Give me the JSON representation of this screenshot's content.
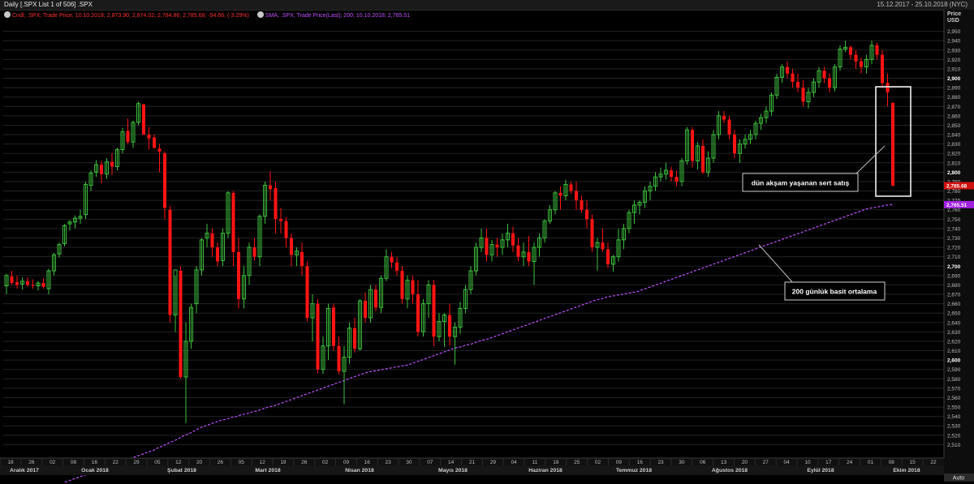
{
  "window": {
    "title": "Daily [.SPX List 1 of 506] .SPX",
    "range": "15.12.2017 - 25.10.2018 (NYC)"
  },
  "legend": {
    "series1": "Cndl; .SPX; Trade Price; 10.10.2018; 2,873.90; 2,874.02; 2,784.86; 2,785.68; -94.66; (-3.29%)",
    "series2": "SMA; .SPX; Trade Price(Last); 200; 10.10.2018; 2,765.51"
  },
  "axis": {
    "price_label": "Price",
    "currency": "USD",
    "auto_label": "Auto",
    "last_price_label": "2,785.68",
    "sma_label": "2,765.51"
  },
  "annotations": {
    "selloff": "dün akşam yaşanan sert satış",
    "sma": "200 günlük basit ortalama"
  },
  "colors": {
    "up": "#3dbf3d",
    "down": "#ff1414",
    "sma": "#c050ff",
    "grid": "#232323",
    "annotation": "#ffffff"
  },
  "chart_data": {
    "type": "candlestick",
    "ylim": [
      2500,
      2960
    ],
    "y_ticks": [
      2510,
      2520,
      2530,
      2540,
      2550,
      2560,
      2570,
      2580,
      2590,
      2600,
      2610,
      2620,
      2630,
      2640,
      2650,
      2660,
      2670,
      2680,
      2690,
      2700,
      2710,
      2720,
      2730,
      2740,
      2750,
      2760,
      2770,
      2780,
      2790,
      2800,
      2810,
      2820,
      2830,
      2840,
      2850,
      2860,
      2870,
      2880,
      2890,
      2900,
      2910,
      2920,
      2930,
      2940,
      2950
    ],
    "date_ticks": [
      "18",
      "26",
      "02",
      "08",
      "16",
      "22",
      "29",
      "05",
      "12",
      "20",
      "26",
      "05",
      "12",
      "19",
      "26",
      "02",
      "09",
      "16",
      "23",
      "30",
      "07",
      "14",
      "21",
      "29",
      "04",
      "11",
      "18",
      "25",
      "02",
      "09",
      "16",
      "23",
      "30",
      "06",
      "13",
      "20",
      "27",
      "04",
      "10",
      "17",
      "24",
      "01",
      "08",
      "15",
      "22"
    ],
    "months": [
      "Aralık 2017",
      "Ocak 2018",
      "Şubat 2018",
      "Mart 2018",
      "Nisan 2018",
      "Mayıs 2018",
      "Haziran 2018",
      "Temmuz 2018",
      "Ağustos 2018",
      "Eylül 2018",
      "Ekim 2018"
    ],
    "candles": [
      [
        2679,
        2692,
        2670,
        2690
      ],
      [
        2689,
        2695,
        2680,
        2682
      ],
      [
        2683,
        2690,
        2676,
        2680
      ],
      [
        2681,
        2688,
        2675,
        2684
      ],
      [
        2684,
        2688,
        2678,
        2680
      ],
      [
        2680,
        2686,
        2676,
        2679
      ],
      [
        2679,
        2684,
        2674,
        2682
      ],
      [
        2682,
        2687,
        2676,
        2678
      ],
      [
        2676,
        2697,
        2670,
        2695
      ],
      [
        2695,
        2714,
        2690,
        2712
      ],
      [
        2713,
        2725,
        2709,
        2723
      ],
      [
        2724,
        2745,
        2721,
        2743
      ],
      [
        2745,
        2749,
        2738,
        2747
      ],
      [
        2747,
        2754,
        2740,
        2751
      ],
      [
        2751,
        2760,
        2745,
        2753
      ],
      [
        2755,
        2790,
        2750,
        2787
      ],
      [
        2786,
        2802,
        2780,
        2799
      ],
      [
        2800,
        2813,
        2795,
        2808
      ],
      [
        2808,
        2812,
        2788,
        2798
      ],
      [
        2798,
        2815,
        2793,
        2811
      ],
      [
        2811,
        2820,
        2797,
        2806
      ],
      [
        2806,
        2826,
        2802,
        2824
      ],
      [
        2824,
        2847,
        2820,
        2843
      ],
      [
        2844,
        2857,
        2830,
        2832
      ],
      [
        2832,
        2855,
        2826,
        2853
      ],
      [
        2853,
        2875,
        2850,
        2873
      ],
      [
        2872,
        2873,
        2845,
        2840
      ],
      [
        2840,
        2848,
        2824,
        2836
      ],
      [
        2837,
        2840,
        2825,
        2826
      ],
      [
        2825,
        2830,
        2800,
        2822
      ],
      [
        2820,
        2822,
        2750,
        2762
      ],
      [
        2760,
        2764,
        2640,
        2648
      ],
      [
        2648,
        2690,
        2630,
        2696
      ],
      [
        2695,
        2700,
        2580,
        2582
      ],
      [
        2582,
        2640,
        2533,
        2620
      ],
      [
        2620,
        2660,
        2612,
        2656
      ],
      [
        2660,
        2700,
        2650,
        2696
      ],
      [
        2696,
        2730,
        2690,
        2728
      ],
      [
        2730,
        2745,
        2720,
        2735
      ],
      [
        2735,
        2740,
        2710,
        2720
      ],
      [
        2720,
        2725,
        2700,
        2705
      ],
      [
        2706,
        2740,
        2700,
        2735
      ],
      [
        2735,
        2780,
        2730,
        2778
      ],
      [
        2778,
        2780,
        2700,
        2715
      ],
      [
        2715,
        2730,
        2655,
        2665
      ],
      [
        2665,
        2700,
        2655,
        2690
      ],
      [
        2690,
        2725,
        2680,
        2720
      ],
      [
        2720,
        2730,
        2706,
        2710
      ],
      [
        2710,
        2755,
        2700,
        2753
      ],
      [
        2753,
        2790,
        2745,
        2786
      ],
      [
        2786,
        2801,
        2770,
        2782
      ],
      [
        2783,
        2790,
        2735,
        2750
      ],
      [
        2750,
        2762,
        2735,
        2748
      ],
      [
        2748,
        2752,
        2720,
        2730
      ],
      [
        2730,
        2735,
        2700,
        2712
      ],
      [
        2712,
        2720,
        2700,
        2716
      ],
      [
        2715,
        2725,
        2690,
        2700
      ],
      [
        2700,
        2705,
        2641,
        2645
      ],
      [
        2645,
        2670,
        2620,
        2660
      ],
      [
        2660,
        2665,
        2586,
        2590
      ],
      [
        2590,
        2625,
        2585,
        2615
      ],
      [
        2615,
        2660,
        2600,
        2655
      ],
      [
        2656,
        2660,
        2610,
        2615
      ],
      [
        2615,
        2625,
        2585,
        2588
      ],
      [
        2588,
        2615,
        2553,
        2603
      ],
      [
        2603,
        2640,
        2596,
        2634
      ],
      [
        2634,
        2645,
        2608,
        2612
      ],
      [
        2612,
        2665,
        2610,
        2663
      ],
      [
        2663,
        2672,
        2640,
        2645
      ],
      [
        2645,
        2680,
        2640,
        2675
      ],
      [
        2675,
        2680,
        2652,
        2656
      ],
      [
        2656,
        2690,
        2650,
        2687
      ],
      [
        2687,
        2718,
        2684,
        2710
      ],
      [
        2710,
        2715,
        2698,
        2704
      ],
      [
        2704,
        2710,
        2690,
        2695
      ],
      [
        2695,
        2700,
        2660,
        2665
      ],
      [
        2665,
        2690,
        2655,
        2685
      ],
      [
        2685,
        2690,
        2660,
        2670
      ],
      [
        2670,
        2685,
        2625,
        2630
      ],
      [
        2630,
        2665,
        2625,
        2660
      ],
      [
        2660,
        2685,
        2645,
        2680
      ],
      [
        2680,
        2685,
        2615,
        2625
      ],
      [
        2625,
        2650,
        2620,
        2641
      ],
      [
        2641,
        2650,
        2614,
        2648
      ],
      [
        2648,
        2660,
        2615,
        2625
      ],
      [
        2625,
        2640,
        2595,
        2635
      ],
      [
        2635,
        2662,
        2628,
        2655
      ],
      [
        2655,
        2680,
        2650,
        2675
      ],
      [
        2675,
        2700,
        2670,
        2695
      ],
      [
        2695,
        2725,
        2690,
        2720
      ],
      [
        2720,
        2740,
        2715,
        2730
      ],
      [
        2730,
        2740,
        2705,
        2712
      ],
      [
        2712,
        2728,
        2705,
        2723
      ],
      [
        2723,
        2730,
        2710,
        2720
      ],
      [
        2720,
        2735,
        2712,
        2728
      ],
      [
        2728,
        2745,
        2720,
        2735
      ],
      [
        2735,
        2742,
        2715,
        2722
      ],
      [
        2722,
        2730,
        2705,
        2710
      ],
      [
        2710,
        2725,
        2700,
        2715
      ],
      [
        2715,
        2732,
        2700,
        2705
      ],
      [
        2705,
        2725,
        2680,
        2720
      ],
      [
        2720,
        2735,
        2710,
        2730
      ],
      [
        2730,
        2750,
        2725,
        2748
      ],
      [
        2748,
        2765,
        2745,
        2760
      ],
      [
        2760,
        2780,
        2755,
        2778
      ],
      [
        2778,
        2785,
        2760,
        2775
      ],
      [
        2775,
        2792,
        2770,
        2787
      ],
      [
        2787,
        2790,
        2777,
        2780
      ],
      [
        2780,
        2790,
        2760,
        2770
      ],
      [
        2770,
        2775,
        2757,
        2760
      ],
      [
        2760,
        2770,
        2740,
        2750
      ],
      [
        2750,
        2755,
        2715,
        2720
      ],
      [
        2720,
        2730,
        2695,
        2725
      ],
      [
        2725,
        2740,
        2715,
        2718
      ],
      [
        2718,
        2725,
        2698,
        2702
      ],
      [
        2702,
        2712,
        2694,
        2710
      ],
      [
        2710,
        2740,
        2705,
        2728
      ],
      [
        2728,
        2745,
        2718,
        2740
      ],
      [
        2740,
        2760,
        2735,
        2757
      ],
      [
        2757,
        2770,
        2745,
        2765
      ],
      [
        2765,
        2770,
        2755,
        2768
      ],
      [
        2768,
        2785,
        2762,
        2780
      ],
      [
        2780,
        2790,
        2770,
        2785
      ],
      [
        2785,
        2800,
        2780,
        2795
      ],
      [
        2795,
        2805,
        2790,
        2798
      ],
      [
        2798,
        2810,
        2792,
        2802
      ],
      [
        2802,
        2806,
        2790,
        2795
      ],
      [
        2795,
        2802,
        2785,
        2790
      ],
      [
        2790,
        2815,
        2785,
        2812
      ],
      [
        2812,
        2848,
        2808,
        2845
      ],
      [
        2845,
        2848,
        2805,
        2812
      ],
      [
        2812,
        2832,
        2803,
        2828
      ],
      [
        2828,
        2835,
        2798,
        2800
      ],
      [
        2800,
        2822,
        2795,
        2815
      ],
      [
        2815,
        2845,
        2810,
        2840
      ],
      [
        2840,
        2865,
        2835,
        2860
      ],
      [
        2860,
        2865,
        2852,
        2856
      ],
      [
        2856,
        2860,
        2835,
        2840
      ],
      [
        2840,
        2845,
        2815,
        2820
      ],
      [
        2820,
        2835,
        2810,
        2830
      ],
      [
        2830,
        2840,
        2825,
        2835
      ],
      [
        2835,
        2845,
        2830,
        2840
      ],
      [
        2840,
        2855,
        2835,
        2852
      ],
      [
        2852,
        2862,
        2845,
        2858
      ],
      [
        2858,
        2870,
        2852,
        2865
      ],
      [
        2865,
        2885,
        2860,
        2882
      ],
      [
        2882,
        2905,
        2878,
        2901
      ],
      [
        2901,
        2915,
        2895,
        2912
      ],
      [
        2912,
        2918,
        2900,
        2905
      ],
      [
        2905,
        2910,
        2890,
        2896
      ],
      [
        2896,
        2905,
        2885,
        2890
      ],
      [
        2890,
        2898,
        2870,
        2875
      ],
      [
        2875,
        2890,
        2868,
        2885
      ],
      [
        2885,
        2900,
        2880,
        2896
      ],
      [
        2896,
        2912,
        2890,
        2908
      ],
      [
        2908,
        2912,
        2895,
        2900
      ],
      [
        2900,
        2905,
        2885,
        2890
      ],
      [
        2890,
        2915,
        2886,
        2912
      ],
      [
        2912,
        2935,
        2908,
        2931
      ],
      [
        2931,
        2940,
        2928,
        2933
      ],
      [
        2933,
        2935,
        2920,
        2925
      ],
      [
        2925,
        2930,
        2910,
        2918
      ],
      [
        2918,
        2922,
        2905,
        2912
      ],
      [
        2912,
        2925,
        2905,
        2920
      ],
      [
        2920,
        2940,
        2915,
        2935
      ],
      [
        2935,
        2938,
        2920,
        2925
      ],
      [
        2925,
        2930,
        2890,
        2895
      ],
      [
        2895,
        2905,
        2870,
        2885
      ],
      [
        2873.9,
        2874.02,
        2784.86,
        2785.68
      ]
    ],
    "sma": [
      2470,
      2472,
      2474,
      2476,
      2478,
      2480,
      2482,
      2484,
      2486,
      2488,
      2490,
      2492,
      2494,
      2496,
      2498,
      2500,
      2502,
      2504,
      2507,
      2509,
      2512,
      2514,
      2517,
      2520,
      2522,
      2525,
      2528,
      2530,
      2532,
      2534,
      2536,
      2537,
      2539,
      2540,
      2542,
      2543,
      2545,
      2546,
      2548,
      2550,
      2551,
      2553,
      2555,
      2557,
      2559,
      2561,
      2563,
      2565,
      2567,
      2569,
      2571,
      2573,
      2575,
      2577,
      2579,
      2581,
      2583,
      2585,
      2587,
      2588,
      2589,
      2590,
      2591,
      2592,
      2593,
      2594,
      2595,
      2597,
      2599,
      2601,
      2603,
      2605,
      2607,
      2609,
      2611,
      2613,
      2614,
      2616,
      2617,
      2619,
      2621,
      2622,
      2624,
      2626,
      2628,
      2630,
      2632,
      2634,
      2636,
      2638,
      2640,
      2642,
      2644,
      2646,
      2648,
      2650,
      2652,
      2654,
      2656,
      2658,
      2660,
      2662,
      2664,
      2665,
      2667,
      2668,
      2669,
      2670,
      2671,
      2672,
      2673,
      2675,
      2677,
      2679,
      2681,
      2683,
      2685,
      2687,
      2689,
      2691,
      2693,
      2695,
      2697,
      2699,
      2701,
      2703,
      2705,
      2707,
      2709,
      2711,
      2713,
      2715,
      2717,
      2719,
      2721,
      2723,
      2725,
      2727,
      2729,
      2731,
      2733,
      2735,
      2737,
      2739,
      2741,
      2743,
      2745,
      2747,
      2749,
      2751,
      2753,
      2755,
      2757,
      2759,
      2761,
      2762,
      2763,
      2764,
      2765,
      2765.51
    ]
  }
}
